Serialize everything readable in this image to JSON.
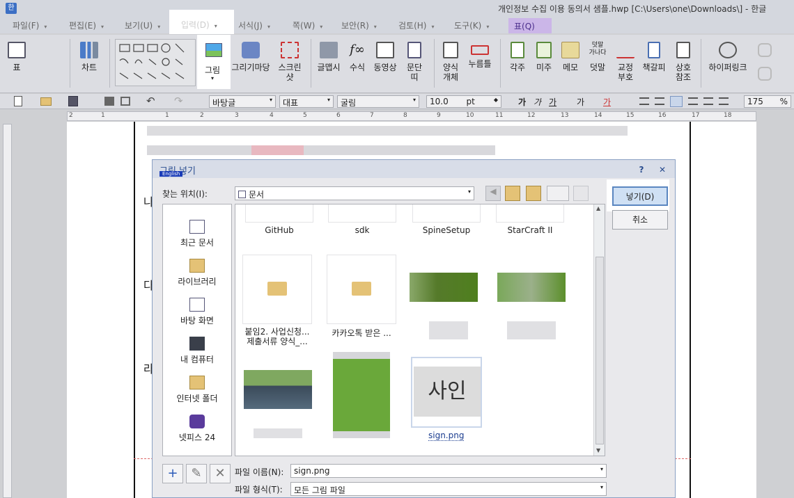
{
  "window": {
    "title": "개인정보 수집 이용 동의서 샘플.hwp [C:\\Users\\one\\Downloads\\] - 한글"
  },
  "menubar": [
    {
      "label": "파일(F)"
    },
    {
      "label": "편집(E)"
    },
    {
      "label": "보기(U)"
    },
    {
      "label": "입력(D)"
    },
    {
      "label": "서식(J)"
    },
    {
      "label": "쪽(W)"
    },
    {
      "label": "보안(R)"
    },
    {
      "label": "검토(H)"
    },
    {
      "label": "도구(K)"
    },
    {
      "label": "표(Q)"
    }
  ],
  "ribbon": {
    "table": "표",
    "chart": "차트",
    "picture": "그림",
    "draw_mart": "그리기마당",
    "screenshot": "스크린\n샷",
    "glyph": "글맵시",
    "equation": "수식",
    "video": "동영상",
    "paragraph": "문단\n띠",
    "form_object": "양식\n개체",
    "push_button": "누름틀",
    "chapter_note": "각주",
    "endnote": "미주",
    "memo": "메모",
    "add_text": "덧말",
    "proof_mark": "교정\n부호",
    "bookmark": "책갈피",
    "cross_ref": "상호\n참조",
    "hyperlink": "하이퍼링크"
  },
  "toolbar": {
    "style": "바탕글",
    "font_set": "대표",
    "font": "굴림",
    "size": "10.0",
    "unit": "pt",
    "zoom": "175",
    "zoom_unit": "%"
  },
  "ruler": [
    "2",
    "1",
    "1",
    "2",
    "3",
    "4",
    "5",
    "6",
    "7",
    "8",
    "9",
    "10",
    "11",
    "12",
    "13",
    "14",
    "15",
    "16",
    "17",
    "18"
  ],
  "dialog": {
    "title": "그림 넣기",
    "lang_badge": "English",
    "help": "?",
    "close": "✕",
    "look_in_label": "찾는 위치(I):",
    "look_in_value": "문서",
    "places": [
      "최근 문서",
      "라이브러리",
      "바탕 화면",
      "내 컴퓨터",
      "인터넷 폴더",
      "넷피스 24"
    ],
    "files_row1": [
      "GitHub",
      "sdk",
      "SpineSetup",
      "StarCraft II"
    ],
    "folders": [
      "붙임2. 사업신청...\n제출서류 양식_...",
      "카카오톡 받은 ..."
    ],
    "selected_file": "sign.png",
    "thumbnail_text": "사인",
    "insert_button": "넣기(D)",
    "cancel_button": "취소",
    "filename_label": "파일 이름(N):",
    "filename_value": "sign.png",
    "filetype_label": "파일 형식(T):",
    "filetype_value": "모든 그림 파일"
  },
  "doc_fragments": [
    "나",
    "다",
    "라"
  ]
}
